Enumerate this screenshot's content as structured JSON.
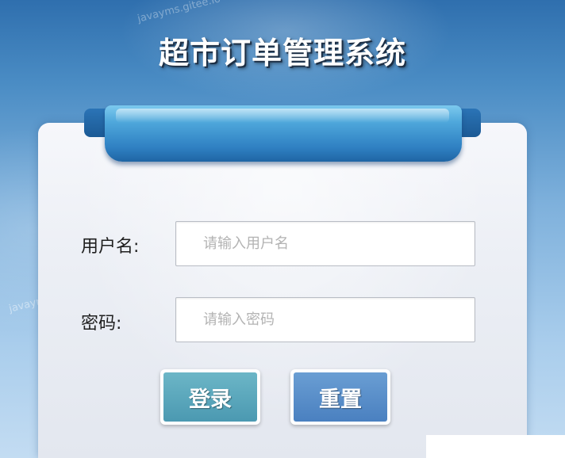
{
  "page": {
    "title": "超市订单管理系统",
    "watermark": "javayms.gitee.io"
  },
  "form": {
    "username_label": "用户名:",
    "username_placeholder": "请输入用户名",
    "password_label": "密码:",
    "password_placeholder": "请输入密码",
    "login_label": "登录",
    "reset_label": "重置"
  },
  "colors": {
    "login_button": "#5aa8bd",
    "reset_button": "#5a90c9",
    "ribbon": "#3d8fcc",
    "panel": "#eceff5"
  }
}
